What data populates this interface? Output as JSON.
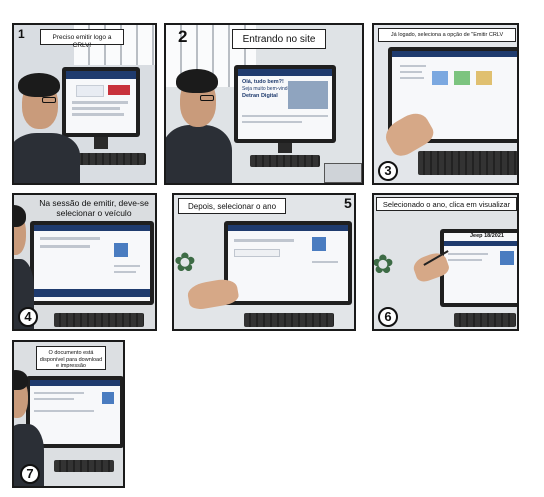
{
  "panels": [
    {
      "number": "1",
      "caption": "Preciso emitir logo a CRLV!"
    },
    {
      "number": "2",
      "caption": "Entrando no site",
      "screen_text": [
        "Olá, tudo bem?!",
        "Seja muito bem-vindo ao",
        "Detran Digital"
      ]
    },
    {
      "number": "3",
      "caption": "Já logado, seleciona a opção de \"Emitir CRLV"
    },
    {
      "number": "4",
      "caption": "Na sessão de emitir, deve-se selecionar o veículo"
    },
    {
      "number": "5",
      "caption": "Depois, selecionar o ano"
    },
    {
      "number": "6",
      "caption": "Selecionado o ano, clica em visualizar",
      "screen_text": "Jeep 18/2021"
    },
    {
      "number": "7",
      "caption": "O documento está disponível para download e impressão"
    }
  ],
  "colors": {
    "site_header_blue": "#1f3b6e",
    "site_red": "#c8323c",
    "ink": "#1a1a1a"
  }
}
